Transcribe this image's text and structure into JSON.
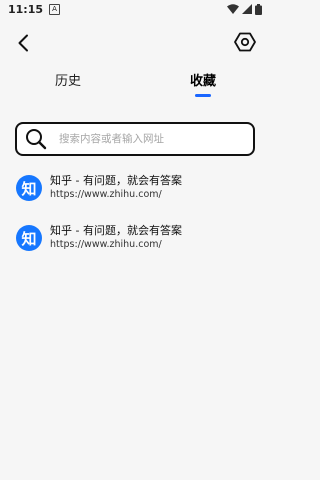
{
  "status_bar": {
    "time": "11:15",
    "notification_glyph": "A"
  },
  "toolbar": {
    "back_icon": "chevron-left-icon",
    "settings_icon": "hexagon-gear-icon"
  },
  "tabs": [
    {
      "label": "历史",
      "active": false
    },
    {
      "label": "收藏",
      "active": true
    }
  ],
  "search": {
    "placeholder": "搜索内容或者输入网址",
    "value": ""
  },
  "favorites": [
    {
      "icon_text": "知",
      "title": "知乎 - 有问题，就会有答案",
      "url": "https://www.zhihu.com/"
    },
    {
      "icon_text": "知",
      "title": "知乎 - 有问题，就会有答案",
      "url": "https://www.zhihu.com/"
    }
  ],
  "colors": {
    "accent": "#1a66ff",
    "icon_bg": "#1677ff",
    "background": "#f6f6f6"
  }
}
